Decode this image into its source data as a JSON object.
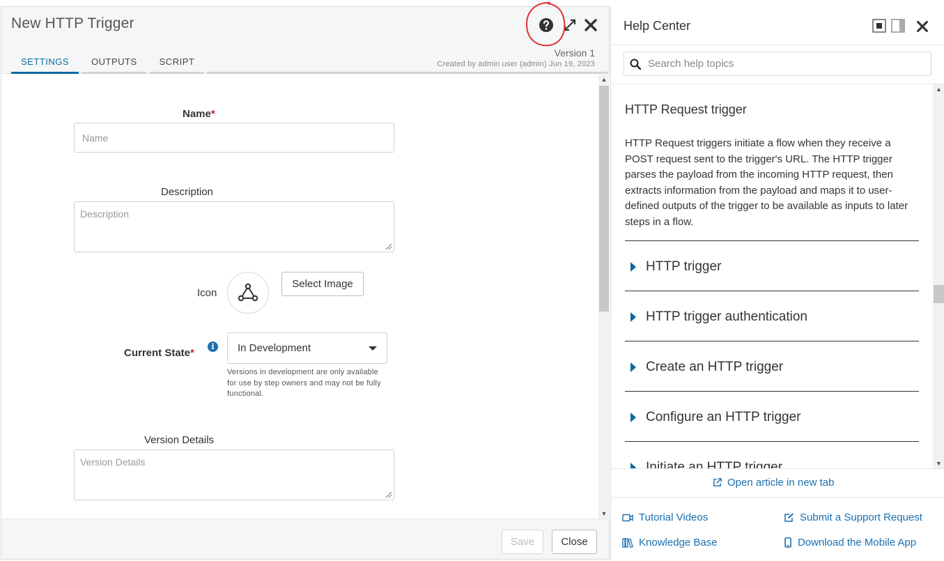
{
  "dialog": {
    "title": "New HTTP Trigger",
    "version_label": "Version 1",
    "version_meta": "Created by admin user (admin) Jun 19, 2023",
    "tabs": [
      {
        "label": "SETTINGS",
        "active": true
      },
      {
        "label": "OUTPUTS",
        "active": false
      },
      {
        "label": "SCRIPT",
        "active": false
      }
    ],
    "icons": {
      "help": "question-circle-icon",
      "expand": "expand-icon",
      "close": "close-icon"
    }
  },
  "form": {
    "name_label": "Name",
    "name_required": "*",
    "name_placeholder": "Name",
    "description_label": "Description",
    "description_placeholder": "Description",
    "icon_label": "Icon",
    "select_image_label": "Select Image",
    "current_state_label": "Current State",
    "current_state_required": "*",
    "current_state_value": "In Development",
    "current_state_hint": "Versions in development are only available for use by step owners and may not be fully functional.",
    "version_details_label": "Version Details",
    "version_details_placeholder": "Version Details"
  },
  "footer": {
    "save_label": "Save",
    "close_label": "Close"
  },
  "help": {
    "title": "Help Center",
    "search_placeholder": "Search help topics",
    "article_title": "HTTP Request trigger",
    "article_text": "HTTP Request triggers initiate a flow when they receive a POST request sent to the trigger's URL. The HTTP trigger parses the payload from the incoming HTTP request, then extracts information from the payload and maps it to user-defined outputs of the trigger to be available as inputs to later steps in a flow.",
    "sections": [
      {
        "label": "HTTP trigger"
      },
      {
        "label": "HTTP trigger authentication"
      },
      {
        "label": "Create an HTTP trigger"
      },
      {
        "label": "Configure an HTTP trigger"
      },
      {
        "label": "Initiate an HTTP trigger"
      }
    ],
    "open_article_label": "Open article in new tab",
    "links": {
      "tutorial_videos": "Tutorial Videos",
      "support_request": "Submit a Support Request",
      "knowledge_base": "Knowledge Base",
      "mobile_app": "Download the Mobile App"
    }
  },
  "colors": {
    "accent": "#0b6aa2",
    "link": "#1a6fb0",
    "required": "#c62828",
    "annotation": "#e03030"
  }
}
